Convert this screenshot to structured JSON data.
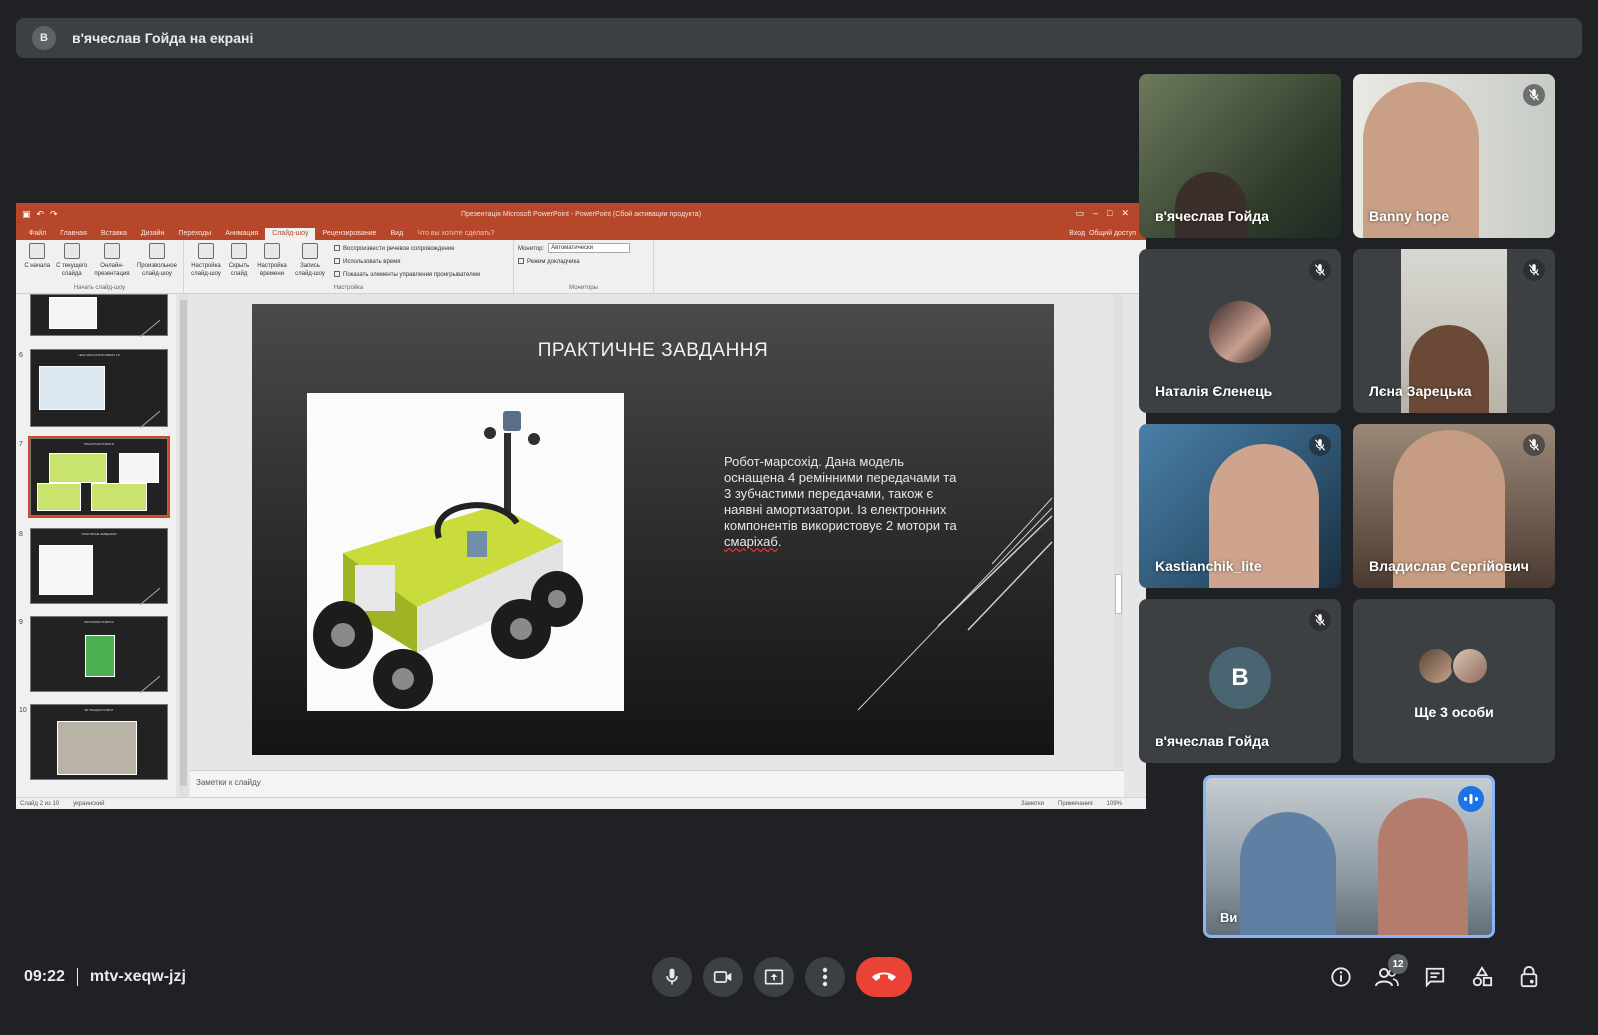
{
  "banner": {
    "initial": "В",
    "text": "в'ячеслав Гойда на екрані"
  },
  "powerpoint": {
    "window_title": "Презентація Microsoft PowerPoint - PowerPoint (Сбой активации продукта)",
    "tabs": [
      "Файл",
      "Главная",
      "Вставка",
      "Дизайн",
      "Переходы",
      "Анимация",
      "Слайд-шоу",
      "Рецензирование",
      "Вид"
    ],
    "active_tab": "Слайд-шоу",
    "tell_me": "Что вы хотите сделать?",
    "signin": "Вход",
    "share": "Общий доступ",
    "ribbon": {
      "start_group": {
        "name": "Начать слайд-шоу",
        "buttons": [
          "С начала",
          "С текущего слайда",
          "Онлайн-презентация",
          "Произвольное слайд-шоу"
        ]
      },
      "setup_group": {
        "name": "Настройка",
        "buttons": [
          "Настройка слайд-шоу",
          "Скрыть слайд",
          "Настройка времени",
          "Запись слайд-шоу"
        ],
        "checks": [
          "Воспроизвести речевое сопровождение",
          "Использовать время",
          "Показать элементы управления проигрывателем"
        ]
      },
      "monitors_group": {
        "name": "Мониторы",
        "monitor_label": "Монитор:",
        "monitor_value": "Автоматически",
        "presenter_view": "Режим докладчика"
      }
    },
    "thumbnails": [
      {
        "num": "",
        "title": ""
      },
      {
        "num": "6",
        "title": "LEGO EDUCATION WEDO 2.0"
      },
      {
        "num": "7",
        "title": "ПРАКТИЧНІ РОБОТИ"
      },
      {
        "num": "8",
        "title": "ПРАКТИЧНЕ ЗАВДАННЯ"
      },
      {
        "num": "9",
        "title": "ПРОГРАМА РОБОТА"
      },
      {
        "num": "10",
        "title": "ЯК ПРАЦЮЄ РОБОТ"
      }
    ],
    "slide": {
      "title": "ПРАКТИЧНЕ ЗАВДАННЯ",
      "body_1": "Робот-марсохід. Дана модель оснащена 4 ремінними передачами та 3 зубчастими передачами, також є наявні амортизатори. Із електронних компонентів використовує 2 мотори та ",
      "body_2": "смаріхаб",
      "body_3": "."
    },
    "notes_placeholder": "Заметки к слайду",
    "status": {
      "slide_of": "Слайд 2 из 10",
      "language": "украинский",
      "notes_btn": "Заметки",
      "comments_btn": "Примечания",
      "zoom": "109%"
    }
  },
  "participants": [
    {
      "name": "в'ячеслав Гойда",
      "muted": false
    },
    {
      "name": "Banny hope",
      "muted": true
    },
    {
      "name": "Наталія Єленець",
      "muted": true
    },
    {
      "name": "Лєна Зарецька",
      "muted": true
    },
    {
      "name": "Kastianchik_lite",
      "muted": true
    },
    {
      "name": "Владислав Сергійович",
      "muted": true
    },
    {
      "name": "в'ячеслав Гойда",
      "muted": true,
      "initial": "В"
    },
    {
      "name": "Ще 3 особи",
      "muted": false
    }
  ],
  "self": {
    "name": "Ви"
  },
  "bottom": {
    "time": "09:22",
    "meeting_code": "mtv-xeqw-jzj",
    "participant_count": "12"
  },
  "colors": {
    "background": "#202124",
    "tile": "#3c4043",
    "end_call": "#ea4335",
    "accent_blue": "#8ab4f8",
    "ppt_brand": "#b7472a"
  },
  "icons": [
    "mic-icon",
    "camera-icon",
    "present-icon",
    "more-vert-icon",
    "call-end-icon",
    "info-icon",
    "people-icon",
    "chat-icon",
    "activities-icon",
    "lock-person-icon",
    "mic-off-icon"
  ]
}
